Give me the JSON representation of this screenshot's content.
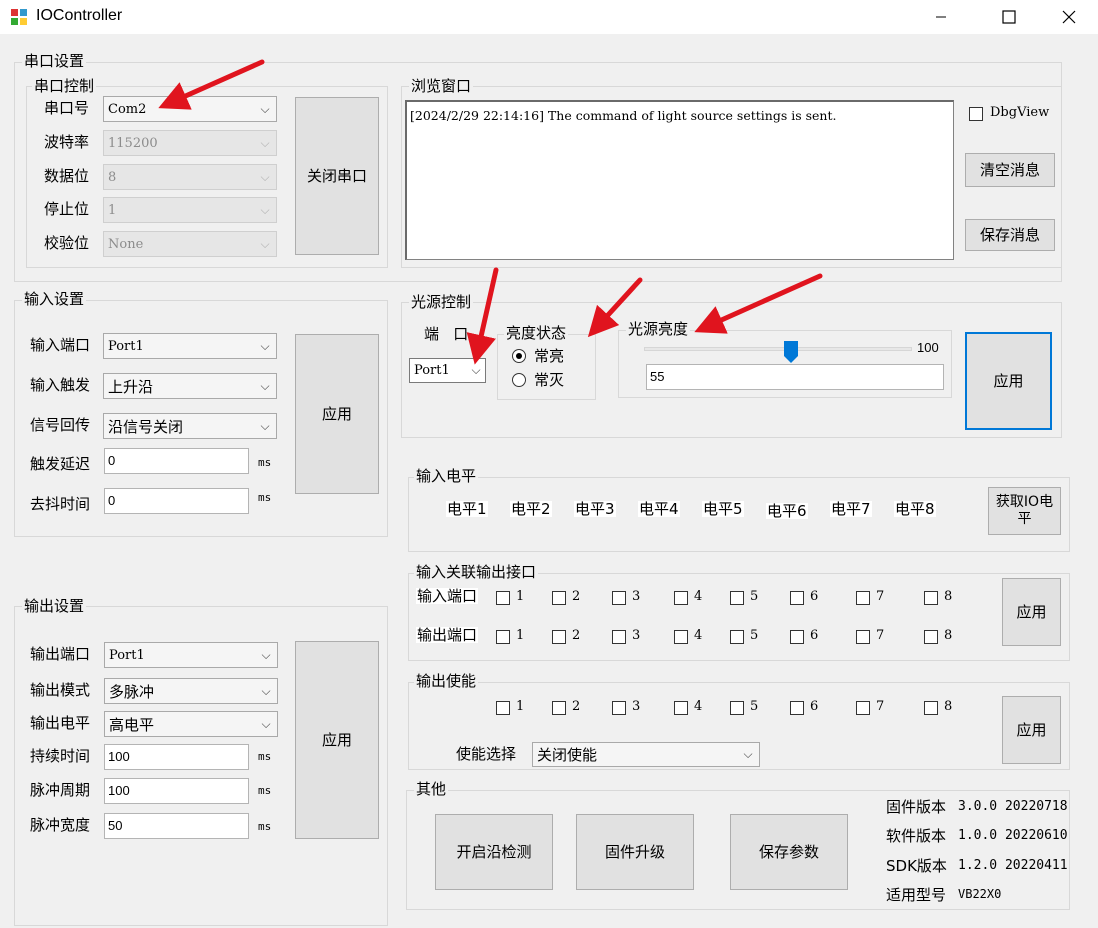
{
  "window": {
    "title": "IOController"
  },
  "serial_settings": {
    "title": "串口设置",
    "control_title": "串口控制",
    "port_label": "串口号",
    "port_value": "Com2",
    "baud_label": "波特率",
    "baud_value": "115200",
    "databits_label": "数据位",
    "databits_value": "8",
    "stopbits_label": "停止位",
    "stopbits_value": "1",
    "parity_label": "校验位",
    "parity_value": "None",
    "close_button": "关闭串口"
  },
  "browse": {
    "title": "浏览窗口",
    "log": "[2024/2/29 22:14:16] The command of light source settings is sent.",
    "dbgview_label": "DbgView",
    "clear_button": "清空消息",
    "save_button": "保存消息"
  },
  "input_settings": {
    "title": "输入设置",
    "port_label": "输入端口",
    "port_value": "Port1",
    "trigger_label": "输入触发",
    "trigger_value": "上升沿",
    "feedback_label": "信号回传",
    "feedback_value": "沿信号关闭",
    "delay_label": "触发延迟",
    "delay_value": "0",
    "debounce_label": "去抖时间",
    "debounce_value": "0",
    "unit": "ms",
    "apply_button": "应用"
  },
  "light_control": {
    "title": "光源控制",
    "port_label": "端   口",
    "port_value": "Port1",
    "state_title": "亮度状态",
    "on_label": "常亮",
    "off_label": "常灭",
    "brightness_title": "光源亮度",
    "slider_max": "100",
    "brightness_value": "55",
    "apply_button": "应用"
  },
  "input_level": {
    "title": "输入电平",
    "levels": [
      "电平1",
      "电平2",
      "电平3",
      "电平4",
      "电平5",
      "电平6",
      "电平7",
      "电平8"
    ],
    "get_button": "获取IO电平"
  },
  "input_assoc": {
    "title": "输入关联输出接口",
    "input_label": "输入端口",
    "output_label": "输出端口",
    "numbers": [
      "1",
      "2",
      "3",
      "4",
      "5",
      "6",
      "7",
      "8"
    ],
    "apply_button": "应用"
  },
  "output_settings": {
    "title": "输出设置",
    "port_label": "输出端口",
    "port_value": "Port1",
    "mode_label": "输出模式",
    "mode_value": "多脉冲",
    "level_label": "输出电平",
    "level_value": "高电平",
    "duration_label": "持续时间",
    "duration_value": "100",
    "period_label": "脉冲周期",
    "period_value": "100",
    "width_label": "脉冲宽度",
    "width_value": "50",
    "unit": "ms",
    "apply_button": "应用"
  },
  "output_enable": {
    "title": "输出使能",
    "numbers": [
      "1",
      "2",
      "3",
      "4",
      "5",
      "6",
      "7",
      "8"
    ],
    "select_label": "使能选择",
    "select_value": "关闭使能",
    "apply_button": "应用"
  },
  "other": {
    "title": "其他",
    "edge_button": "开启沿检测",
    "firmware_button": "固件升级",
    "save_button": "保存参数",
    "firmware_label": "固件版本",
    "firmware_value": "3.0.0 20220718",
    "software_label": "软件版本",
    "software_value": "1.0.0 20220610",
    "sdk_label": "SDK版本",
    "sdk_value": "1.2.0 20220411",
    "model_label": "适用型号",
    "model_value": "VB22X0"
  },
  "colors": {
    "accent": "#0078d7",
    "arrow": "#e0141e",
    "background": "#f0f0f0"
  }
}
